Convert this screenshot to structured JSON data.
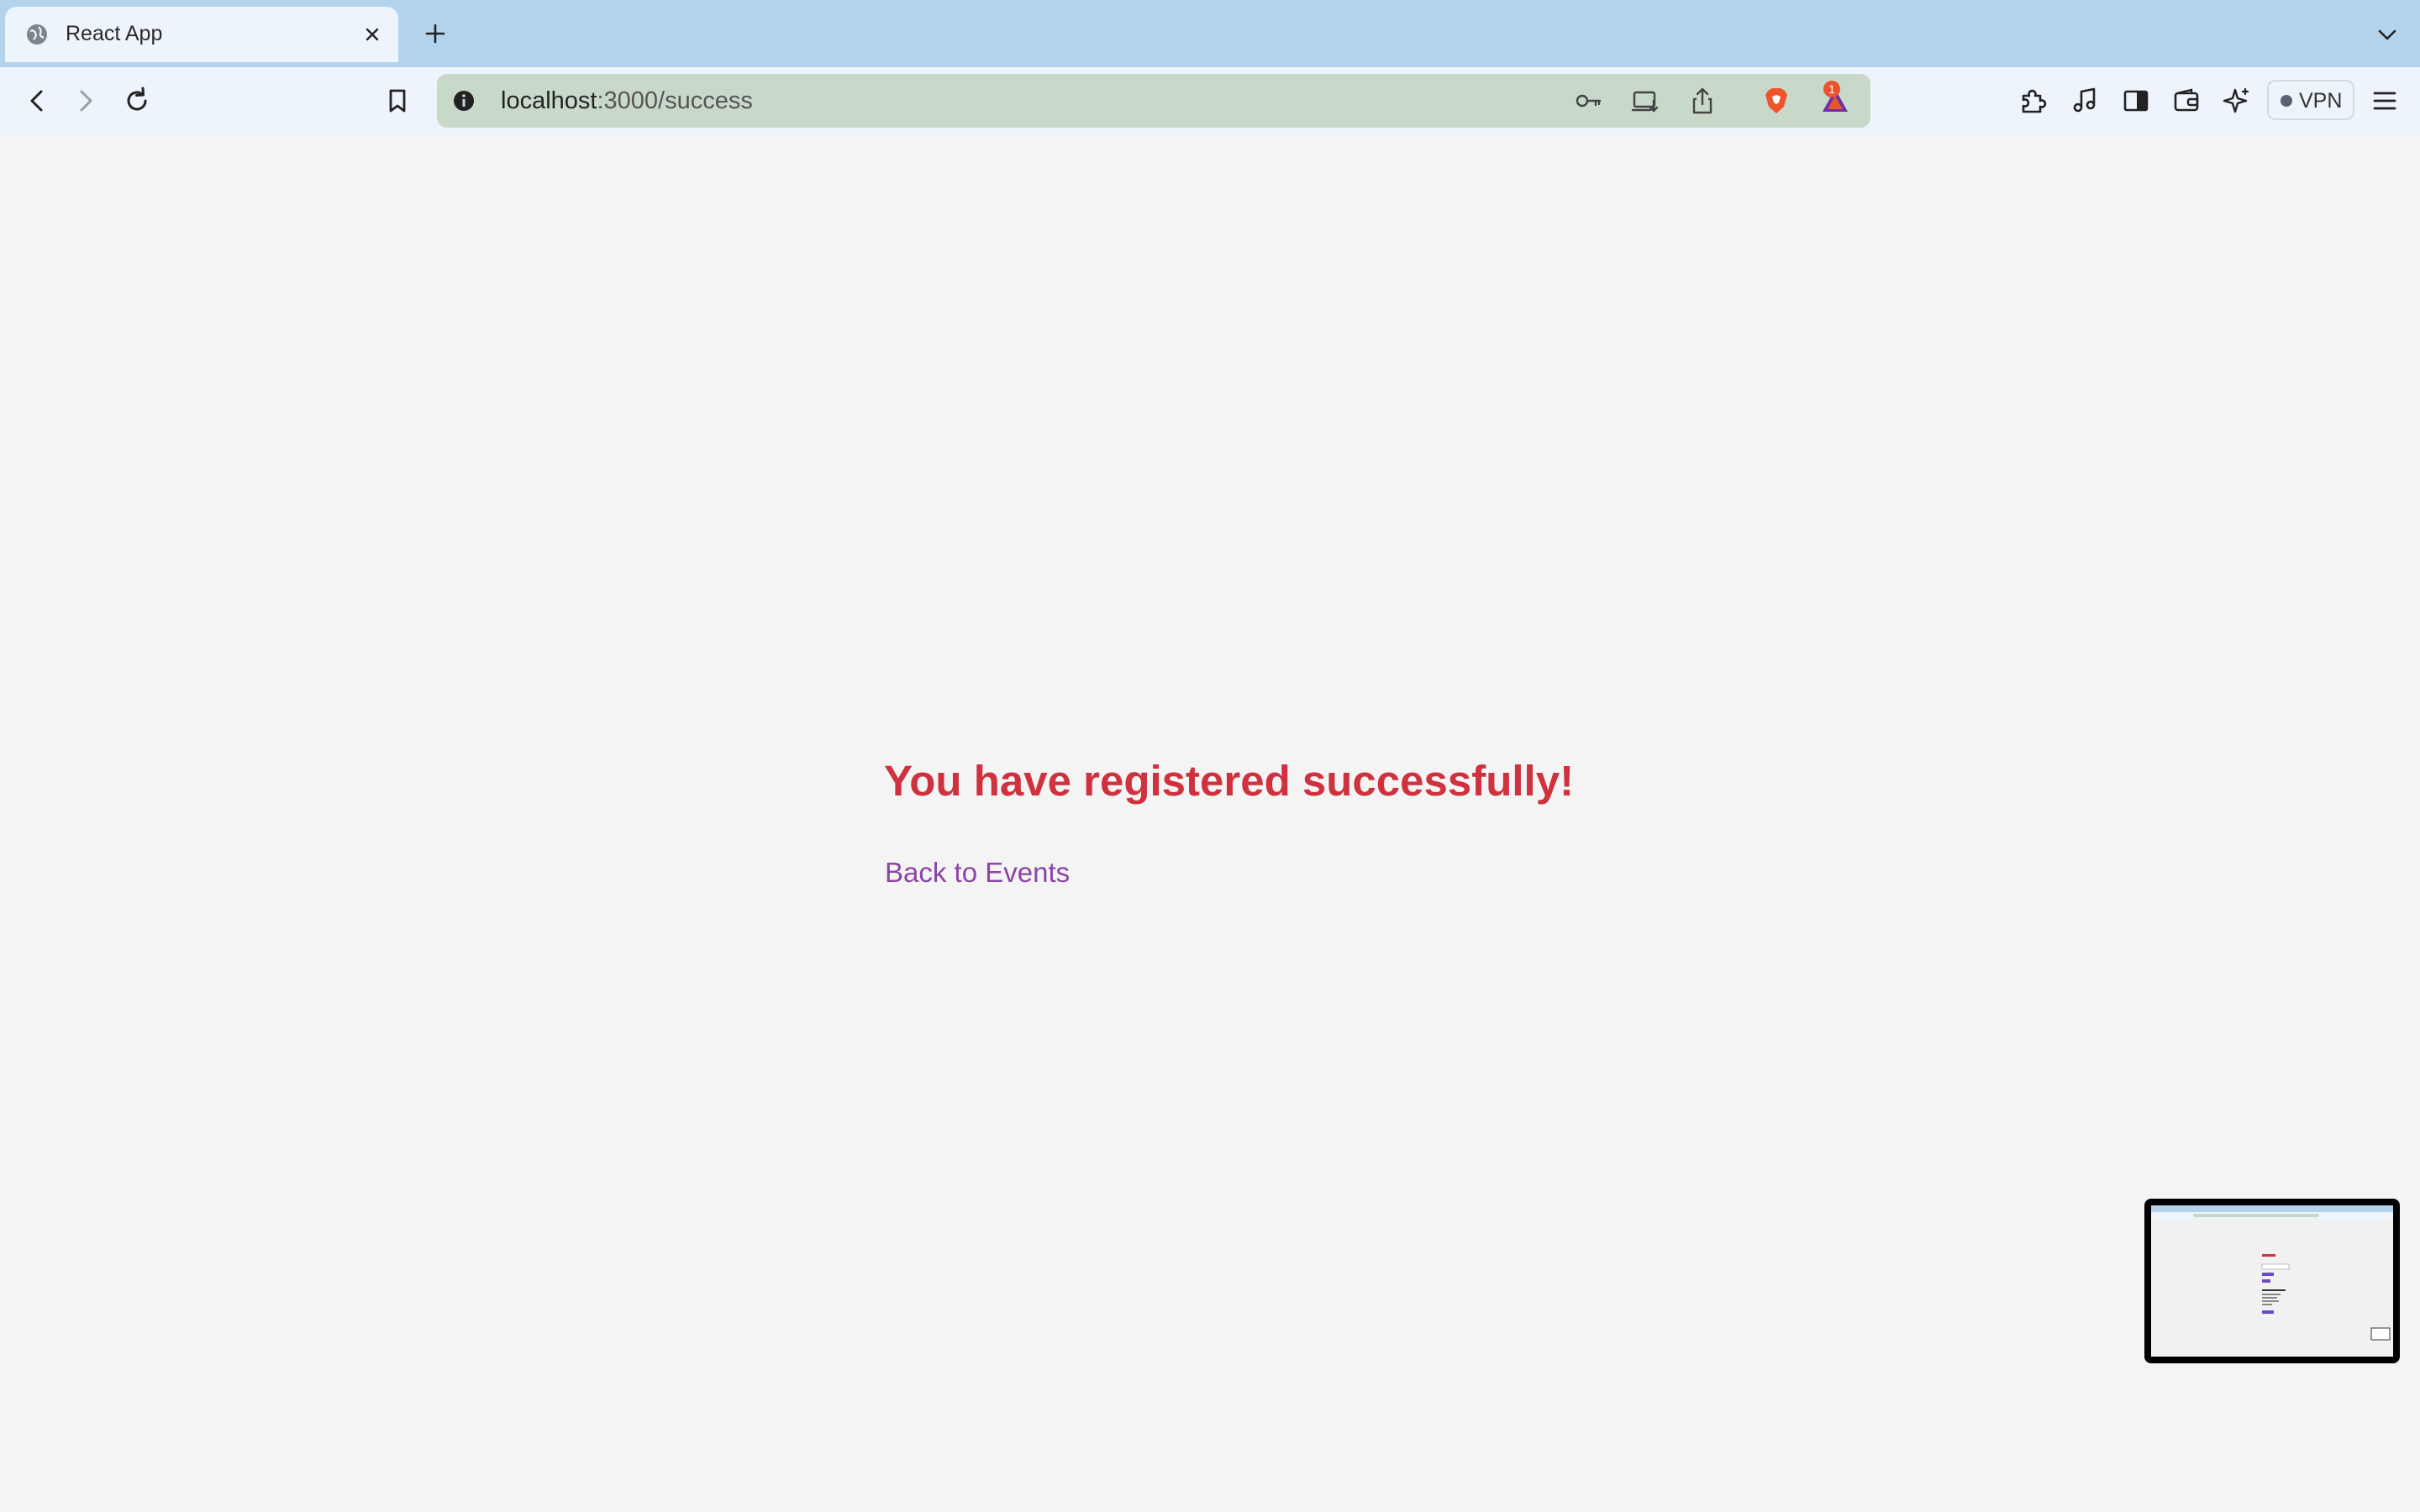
{
  "browser": {
    "tab": {
      "title": "React App"
    },
    "url": {
      "host": "localhost",
      "path": ":3000/success"
    },
    "extension_badge_count": "1",
    "vpn_label": "VPN"
  },
  "page": {
    "heading": "You have registered successfully!",
    "back_link": "Back to Events"
  },
  "colors": {
    "heading": "#d0313f",
    "link": "#8c44a6",
    "page_background": "#f4f4f4",
    "tabstrip": "#b3d3ec",
    "toolbar": "#edf4fb",
    "omnibox": "#c9d9c9"
  }
}
